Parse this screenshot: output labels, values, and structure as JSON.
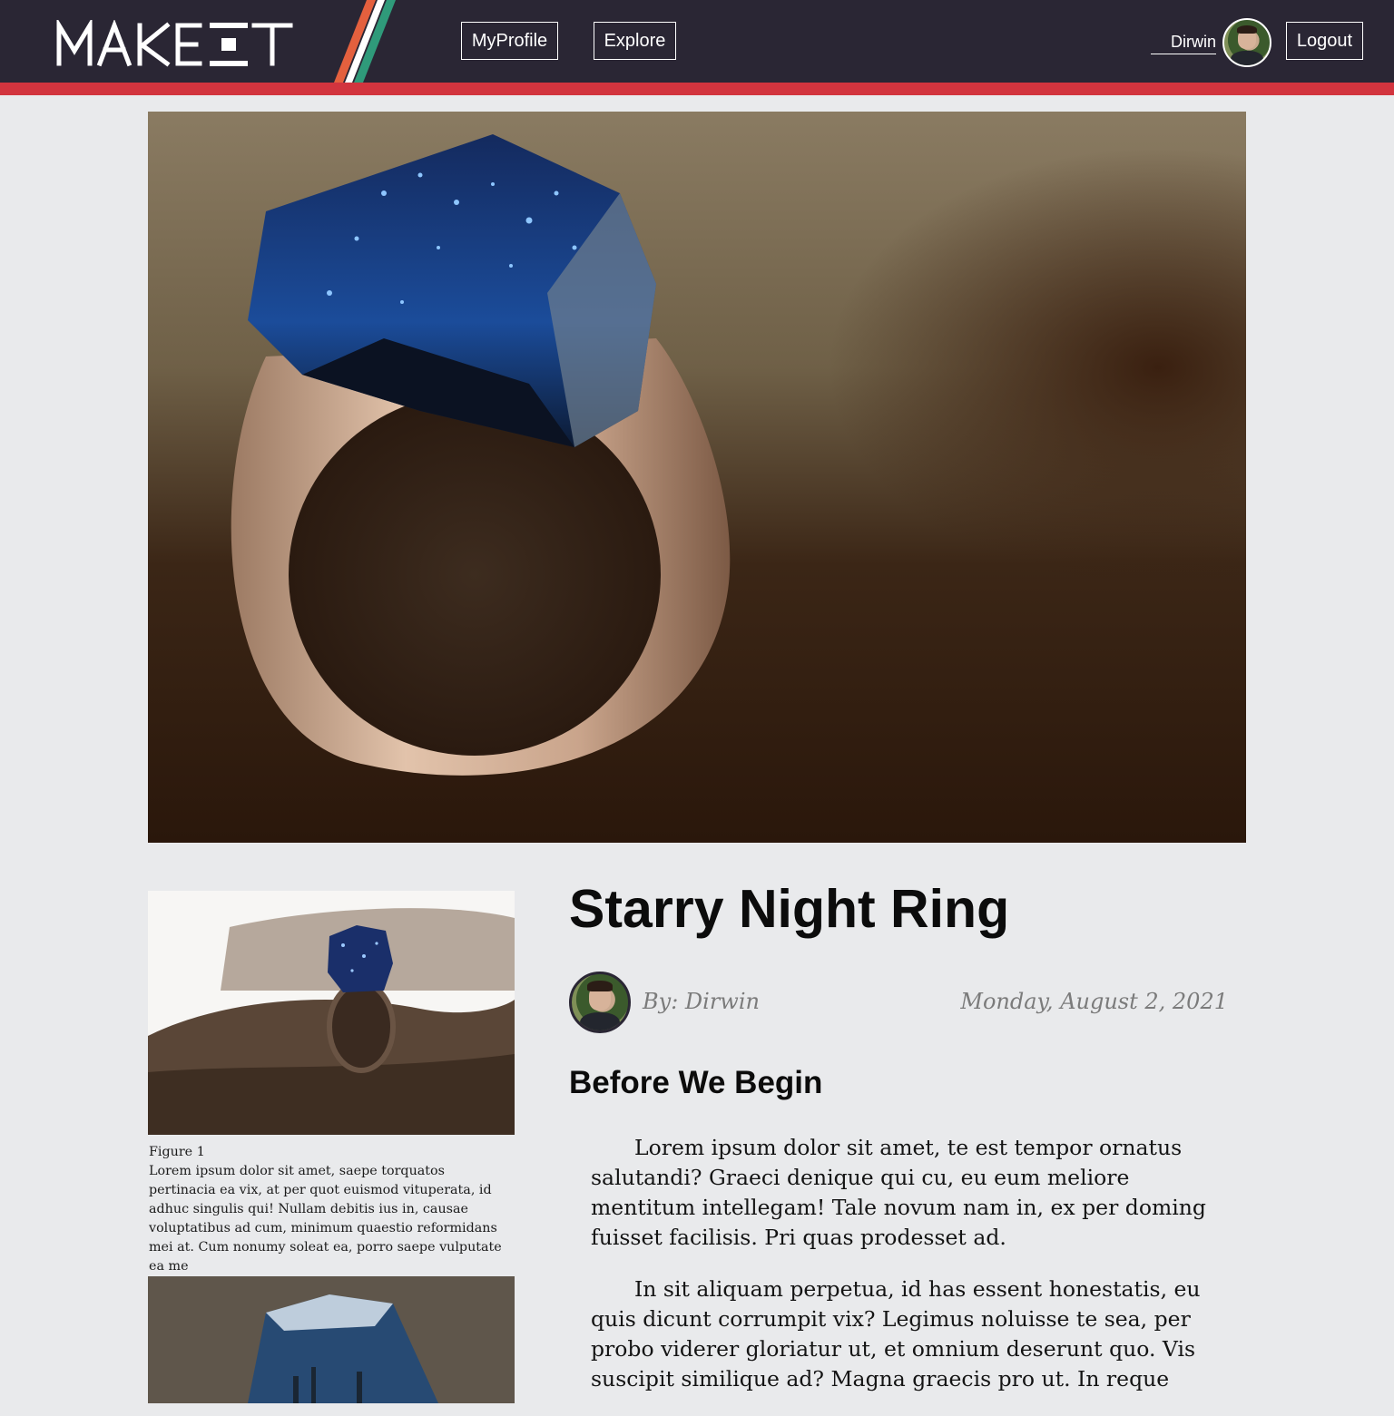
{
  "header": {
    "logo_text": "MAKEIT",
    "nav": {
      "myprofile_label": "MyProfile",
      "explore_label": "Explore"
    },
    "user": {
      "name": "Dirwin",
      "avatar_icon": "user-avatar-photo"
    },
    "logout_label": "Logout",
    "colors": {
      "bar": "#2a2634",
      "accent_red": "#d2343e",
      "stripe_orange": "#e4603e",
      "stripe_white": "#ffffff",
      "stripe_green": "#2f9a7a"
    }
  },
  "article": {
    "title": "Starry Night Ring",
    "byline": "By: Dirwin",
    "date": "Monday, August 2, 2021",
    "section_heading": "Before We Begin",
    "paragraphs": [
      "Lorem ipsum dolor sit amet, te est tempor ornatus salutandi? Graeci denique qui cu, eu eum meliore mentitum intellegam! Tale novum nam in, ex per doming fuisset facilisis. Pri quas prodesset ad.",
      "In sit aliquam perpetua, id has essent honestatis, eu quis dicunt corrumpit vix? Legimus noluisse te sea, per probo viderer gloriatur ut, et omnium deserunt quo. Vis suscipit similique ad? Magna graecis pro ut. In reque"
    ]
  },
  "figures": [
    {
      "label": "Figure 1",
      "caption": "Lorem ipsum dolor sit amet, saepe torquatos pertinacia ea vix, at per quot euismod vituperata, id adhuc singulis qui! Nullam debitis ius in, causae voluptatibus ad cum, minimum quaestio reformidans mei at. Cum nonumy soleat ea, porro saepe vulputate ea me"
    }
  ]
}
